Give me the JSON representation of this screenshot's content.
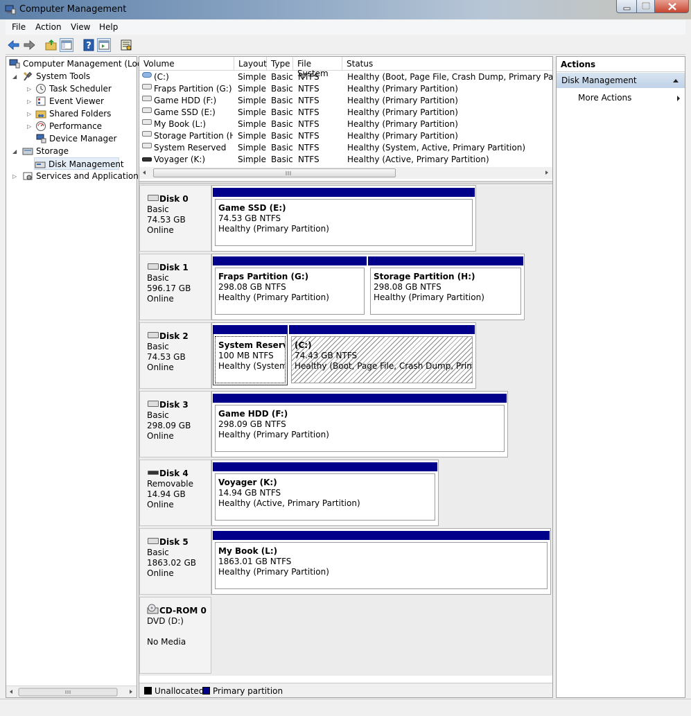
{
  "window": {
    "title": "Computer Management"
  },
  "menu": [
    "File",
    "Action",
    "View",
    "Help"
  ],
  "tree": {
    "root": "Computer Management (Local",
    "system_tools": "System Tools",
    "task_scheduler": "Task Scheduler",
    "event_viewer": "Event Viewer",
    "shared_folders": "Shared Folders",
    "performance": "Performance",
    "device_manager": "Device Manager",
    "storage": "Storage",
    "disk_management": "Disk Management",
    "services": "Services and Applications"
  },
  "volume_list": {
    "columns": [
      "Volume",
      "Layout",
      "Type",
      "File System",
      "Status"
    ],
    "rows": [
      {
        "volume": "(C:)",
        "layout": "Simple",
        "type": "Basic",
        "fs": "NTFS",
        "status": "Healthy (Boot, Page File, Crash Dump, Primary Partition)",
        "icon": "os-drive-icon"
      },
      {
        "volume": "Fraps Partition (G:)",
        "layout": "Simple",
        "type": "Basic",
        "fs": "NTFS",
        "status": "Healthy (Primary Partition)",
        "icon": "drive-icon"
      },
      {
        "volume": "Game HDD (F:)",
        "layout": "Simple",
        "type": "Basic",
        "fs": "NTFS",
        "status": "Healthy (Primary Partition)",
        "icon": "drive-icon"
      },
      {
        "volume": "Game SSD (E:)",
        "layout": "Simple",
        "type": "Basic",
        "fs": "NTFS",
        "status": "Healthy (Primary Partition)",
        "icon": "drive-icon"
      },
      {
        "volume": "My Book (L:)",
        "layout": "Simple",
        "type": "Basic",
        "fs": "NTFS",
        "status": "Healthy (Primary Partition)",
        "icon": "drive-icon"
      },
      {
        "volume": "Storage Partition (H:)",
        "layout": "Simple",
        "type": "Basic",
        "fs": "NTFS",
        "status": "Healthy (Primary Partition)",
        "icon": "drive-icon"
      },
      {
        "volume": "System Reserved",
        "layout": "Simple",
        "type": "Basic",
        "fs": "NTFS",
        "status": "Healthy (System, Active, Primary Partition)",
        "icon": "drive-icon"
      },
      {
        "volume": "Voyager (K:)",
        "layout": "Simple",
        "type": "Basic",
        "fs": "NTFS",
        "status": "Healthy (Active, Primary Partition)",
        "icon": "removable-drive-icon"
      }
    ]
  },
  "disks": [
    {
      "name": "Disk 0",
      "kind": "Basic",
      "size": "74.53 GB",
      "state": "Online",
      "parts": [
        {
          "name": "Game SSD  (E:)",
          "size": "74.53 GB NTFS",
          "status": "Healthy (Primary Partition)"
        }
      ]
    },
    {
      "name": "Disk 1",
      "kind": "Basic",
      "size": "596.17 GB",
      "state": "Online",
      "parts": [
        {
          "name": "Fraps Partition  (G:)",
          "size": "298.08 GB NTFS",
          "status": "Healthy (Primary Partition)"
        },
        {
          "name": "Storage Partition  (H:)",
          "size": "298.08 GB NTFS",
          "status": "Healthy (Primary Partition)"
        }
      ]
    },
    {
      "name": "Disk 2",
      "kind": "Basic",
      "size": "74.53 GB",
      "state": "Online",
      "parts": [
        {
          "name": "System Reserved",
          "size": "100 MB NTFS",
          "status": "Healthy (System, Active, Primary Partition)"
        },
        {
          "name": "(C:)",
          "size": "74.43 GB NTFS",
          "status": "Healthy (Boot, Page File, Crash Dump, Primary Partition)"
        }
      ]
    },
    {
      "name": "Disk 3",
      "kind": "Basic",
      "size": "298.09 GB",
      "state": "Online",
      "parts": [
        {
          "name": "Game HDD  (F:)",
          "size": "298.09 GB NTFS",
          "status": "Healthy (Primary Partition)"
        }
      ]
    },
    {
      "name": "Disk 4",
      "kind": "Removable",
      "size": "14.94 GB",
      "state": "Online",
      "parts": [
        {
          "name": "Voyager  (K:)",
          "size": "14.94 GB NTFS",
          "status": "Healthy (Active, Primary Partition)"
        }
      ]
    },
    {
      "name": "Disk 5",
      "kind": "Basic",
      "size": "1863.02 GB",
      "state": "Online",
      "parts": [
        {
          "name": "My Book  (L:)",
          "size": "1863.01 GB NTFS",
          "status": "Healthy (Primary Partition)"
        }
      ]
    }
  ],
  "cdrom": {
    "name": "CD-ROM 0",
    "drive": "DVD (D:)",
    "media": "No Media"
  },
  "legend": {
    "unallocated": "Unallocated",
    "primary": "Primary partition",
    "unallocated_color": "#000000",
    "primary_color": "#00008b"
  },
  "actions": {
    "title": "Actions",
    "section": "Disk Management",
    "more": "More Actions"
  }
}
